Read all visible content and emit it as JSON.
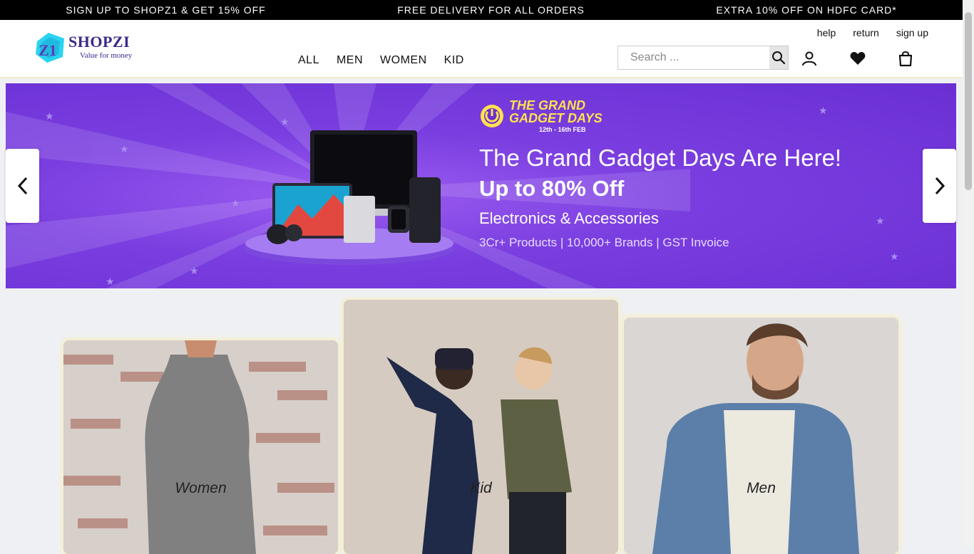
{
  "promo": {
    "items": [
      "SIGN UP TO SHOPZ1 & GET 15% OFF",
      "FREE DELIVERY FOR ALL ORDERS",
      "EXTRA 10% OFF ON HDFC CARD*"
    ]
  },
  "header": {
    "brand": "SHOPZI",
    "tagline": "Value for money",
    "nav": [
      "ALL",
      "MEN",
      "WOMEN",
      "KID"
    ],
    "util_links": [
      "help",
      "return",
      "sign up"
    ],
    "search_placeholder": "Search ...",
    "icons": [
      "search-icon",
      "user-icon",
      "heart-icon",
      "shopping-bag-icon"
    ]
  },
  "banner": {
    "badge_line1": "THE GRAND",
    "badge_line2": "GADGET DAYS",
    "badge_date": "12th - 16th FEB",
    "headline": "The Grand Gadget Days Are Here!",
    "offer": "Up to 80% Off",
    "category": "Electronics & Accessories",
    "subline": "3Cr+ Products | 10,000+ Brands | GST Invoice",
    "colors": {
      "bg": "#7a3ee0",
      "badge": "#ffe14d"
    }
  },
  "categories": [
    {
      "label": "Women"
    },
    {
      "label": "Kid"
    },
    {
      "label": "Men"
    }
  ],
  "colors": {
    "accent": "#3b2a8a",
    "promo_bg": "#000000"
  }
}
